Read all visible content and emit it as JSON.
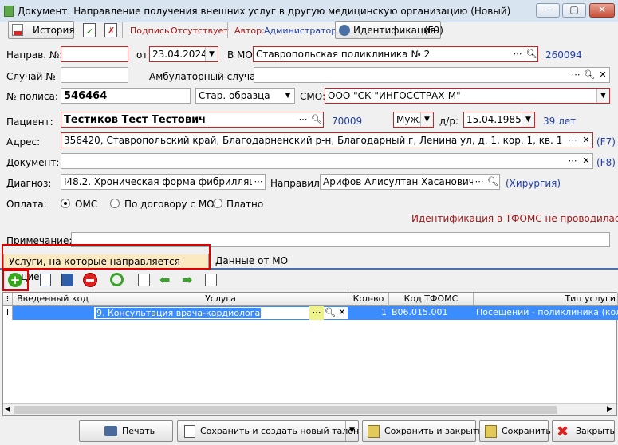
{
  "window": {
    "title": "Документ: Направление получения внешних услуг в другую медицинскую организацию (Новый)",
    "min": "–",
    "restore": "▢",
    "close": "✕"
  },
  "toolbar": {
    "history": "История",
    "signature_label": "Подпись:",
    "signature_value": "Отсутствует",
    "author_label": "Автор:",
    "author_value": "Администратор",
    "ident": "Идентификация",
    "ident_key": "(F9)"
  },
  "form": {
    "naprav_label": "Направ. №:",
    "naprav_value": "",
    "ot_label": "от",
    "ot_value": "23.04.2024",
    "vmo_label": "В МО:",
    "vmo_value": "Ставропольская поликлиника № 2",
    "vmo_code": "260094",
    "case_label": "Случай №",
    "case_value": "",
    "amb_label": "Амбулаторный случай:",
    "amb_value": "",
    "policy_label": "№ полиса:",
    "policy_value": "546464",
    "policy_type": "Стар. образца",
    "smo_label": "СМО:",
    "smo_value": "ООО \"СК \"ИНГОССТРАХ-М\"",
    "patient_label": "Пациент:",
    "patient_value": "Тестиков Тест Тестович",
    "patient_code": "70009",
    "sex_value": "Муж.",
    "dob_label": "д/р:",
    "dob_value": "15.04.1985",
    "age": "39 лет",
    "address_label": "Адрес:",
    "address_value": "356420, Ставропольский край, Благодарненский р-н, Благодарный г, Ленина ул, д. 1, кор. 1, кв. 1",
    "address_key": "(F7)",
    "doc_label": "Документ:",
    "doc_value": "",
    "doc_key": "(F8)",
    "diag_label": "Диагноз:",
    "diag_value": "I48.2. Хроническая форма фибрилляции",
    "napravil_label": "Направил:",
    "napravil_value": "Арифов Алисултан Хасанович",
    "napravil_dept": "(Хирургия)",
    "pay_label": "Оплата:",
    "pay_options": [
      "ОМС",
      "По договору с МО",
      "Платно"
    ],
    "tfoms_msg": "Идентификация в ТФОМС не проводилась!",
    "note_label": "Примечание:",
    "note_value": ""
  },
  "tabs": [
    "Услуги, на которые направляется пациент",
    "Данные от МО"
  ],
  "grid": {
    "headers": [
      "Введенный код",
      "Услуга",
      "Кол-во",
      "Код ТФОМС",
      "Тип услуги"
    ],
    "rows": [
      [
        "",
        "9. Консультация врача-кардиолога",
        "1",
        "B06.015.001",
        "Посещений - поликлиника (количе"
      ]
    ]
  },
  "buttons": {
    "print": "Печать",
    "save_new": "Сохранить и создать новый талон",
    "save_close": "Сохранить и закрыть",
    "save": "Сохранить",
    "close": "Закрыть"
  },
  "colors": {
    "accent": "#3a8cff",
    "required": "#d02020",
    "link": "#1f3fa8",
    "warn": "#a01818"
  }
}
